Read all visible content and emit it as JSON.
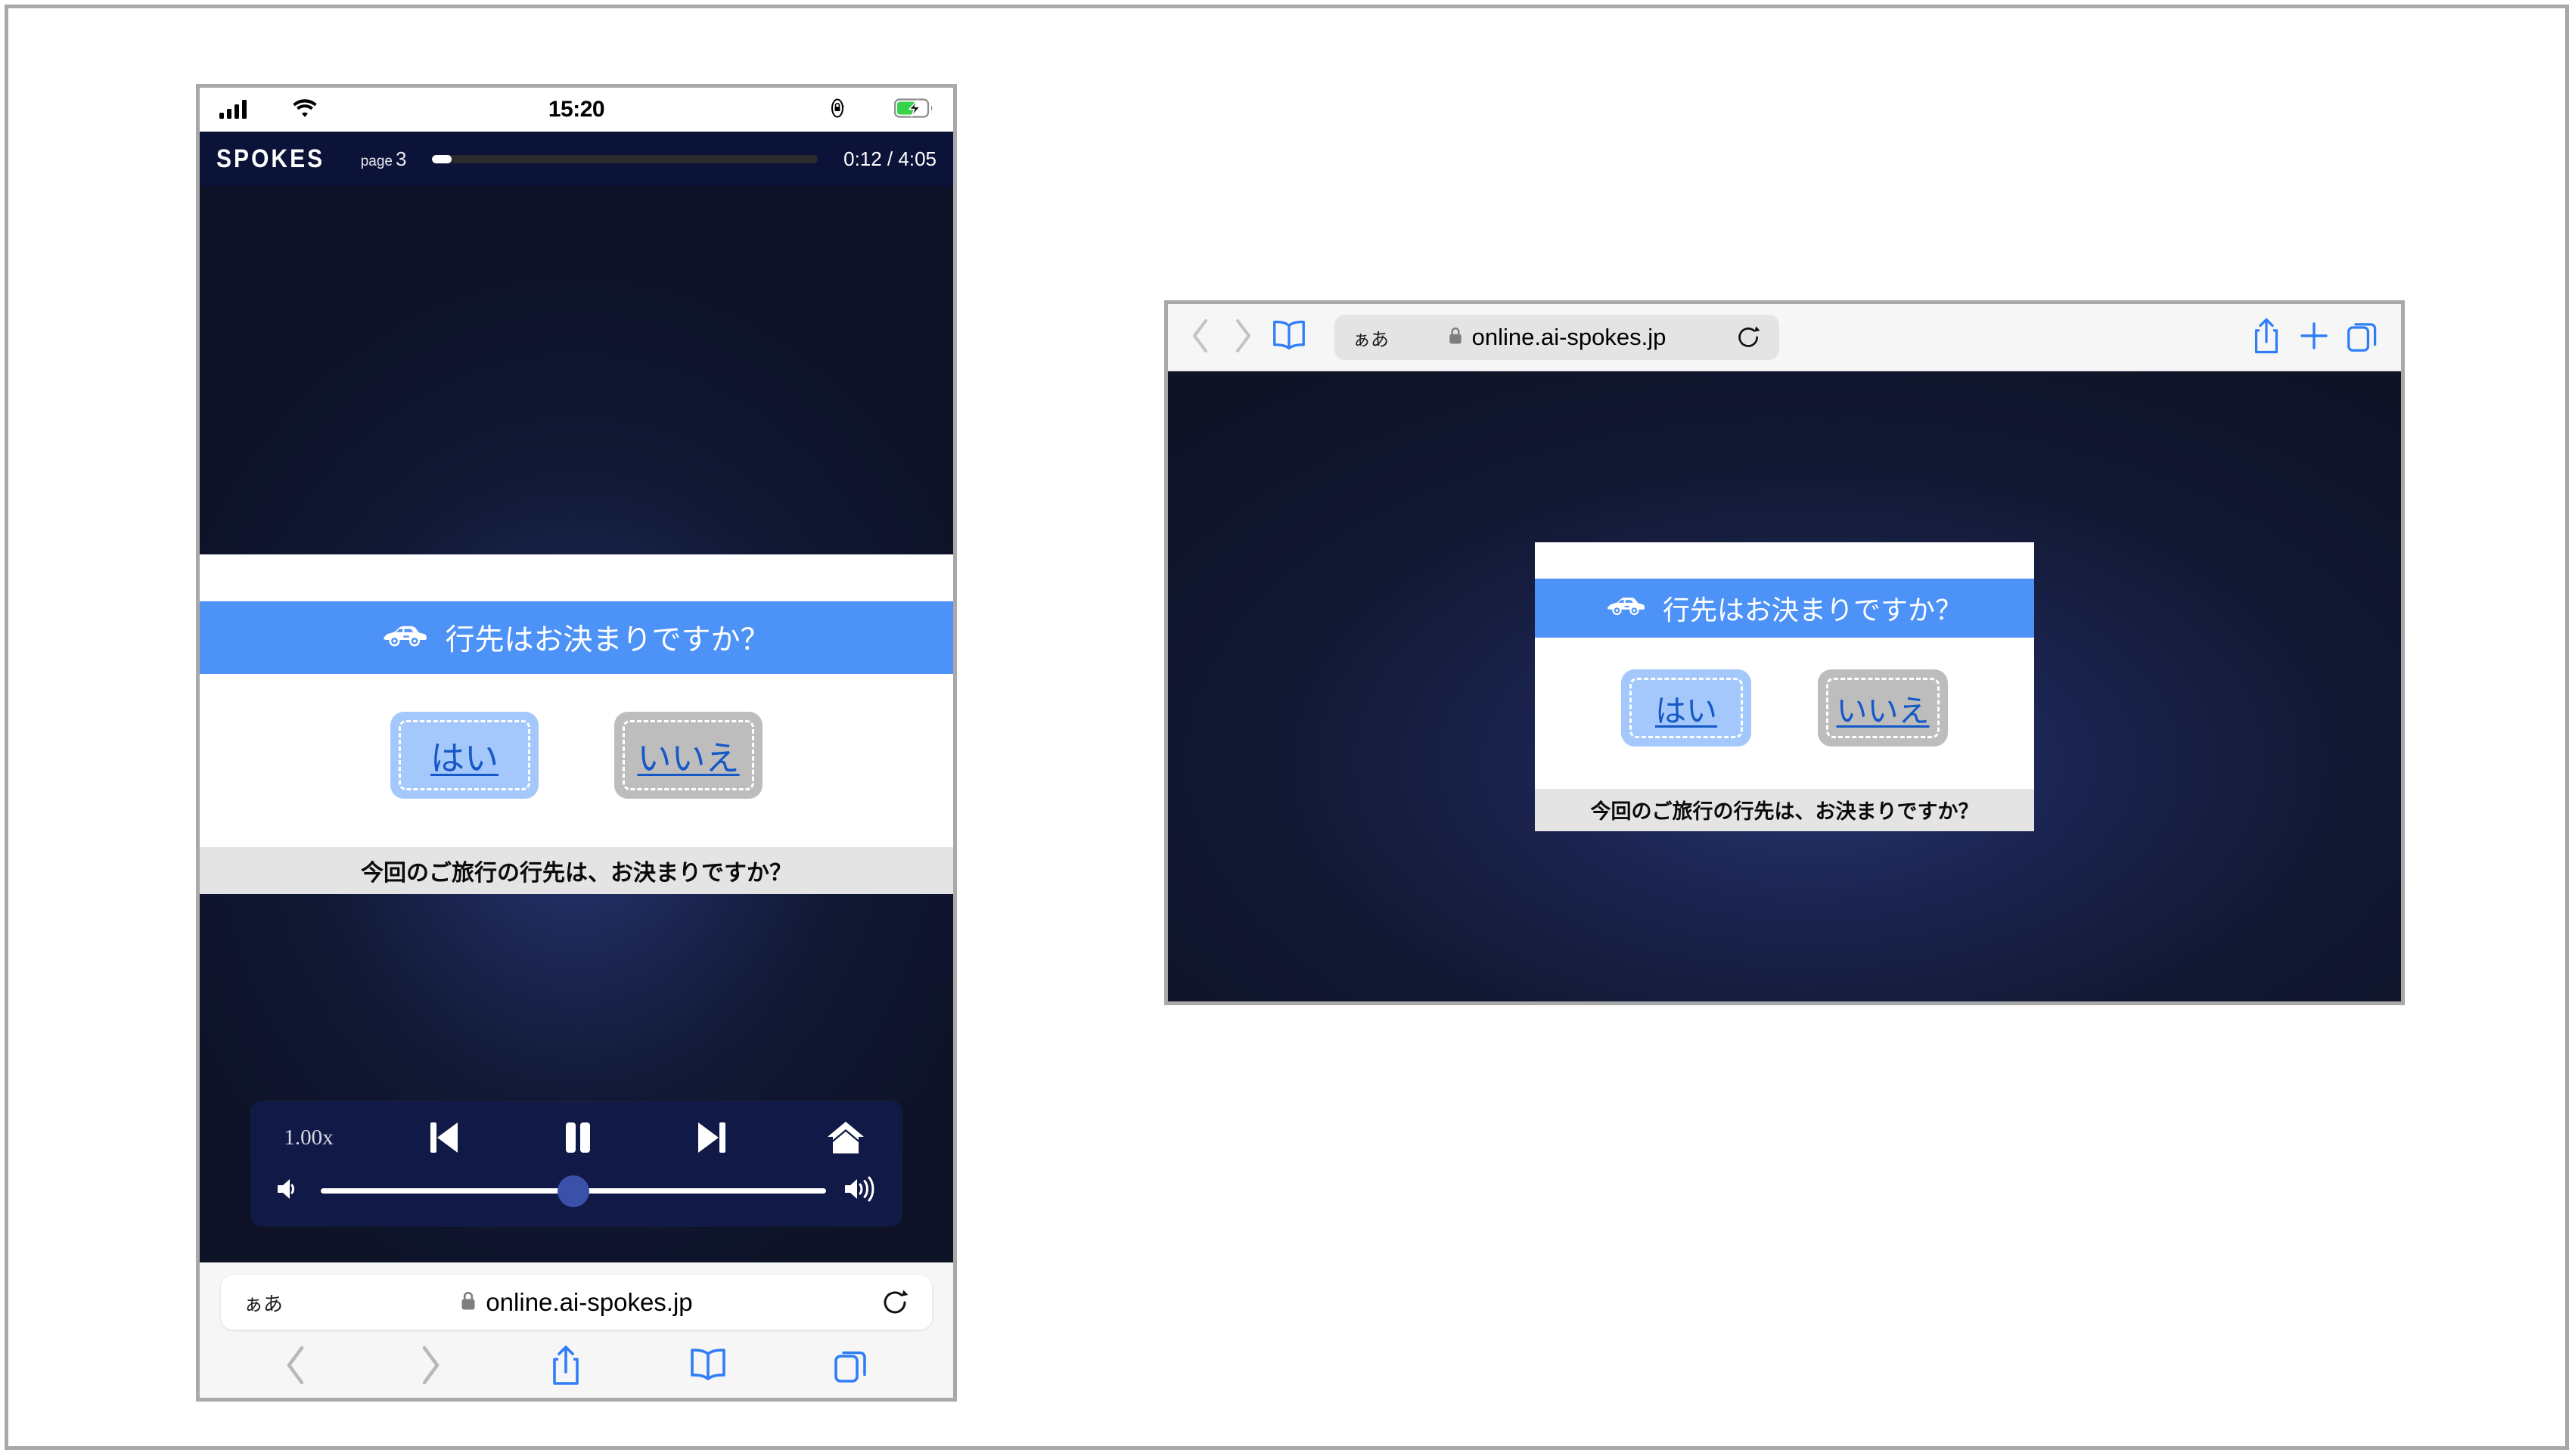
{
  "phone": {
    "status_bar": {
      "signal_icon": "cellular-signal-icon",
      "wifi_icon": "wifi-icon",
      "time": "15:20",
      "orientation_lock_icon": "rotation-lock-icon",
      "battery_icon": "battery-charging-icon"
    },
    "app_header": {
      "brand": "SPOKES",
      "page_word": "page",
      "page_number": "3",
      "progress_percent": 5,
      "time_elapsed": "0:12",
      "time_separator": "/",
      "time_total": "4:05",
      "time_display": "0:12 / 4:05"
    },
    "slide": {
      "question_icon": "car-icon",
      "question_text": "行先はお決まりですか？",
      "answers": [
        {
          "label": "はい",
          "variant": "primary"
        },
        {
          "label": "いいえ",
          "variant": "secondary"
        }
      ],
      "caption": "今回のご旅行の行先は、お決まりですか？"
    },
    "player": {
      "speed_label": "1.00x",
      "prev_icon": "skip-previous-icon",
      "pause_icon": "pause-icon",
      "next_icon": "skip-next-icon",
      "home_icon": "home-icon",
      "volume_low_icon": "volume-low-icon",
      "volume_high_icon": "volume-high-icon",
      "volume_percent": 50
    },
    "safari": {
      "text_size_label": "ぁあ",
      "lock_icon": "lock-icon",
      "url": "online.ai-spokes.jp",
      "reload_icon": "reload-icon",
      "back_icon": "chevron-left-icon",
      "forward_icon": "chevron-right-icon",
      "share_icon": "share-icon",
      "bookmarks_icon": "book-icon",
      "tabs_icon": "tabs-icon"
    }
  },
  "tablet": {
    "toolbar": {
      "back_icon": "chevron-left-icon",
      "forward_icon": "chevron-right-icon",
      "bookmarks_icon": "book-icon",
      "text_size_label": "ぁあ",
      "lock_icon": "lock-icon",
      "url": "online.ai-spokes.jp",
      "reload_icon": "reload-icon",
      "share_icon": "share-icon",
      "new_tab_icon": "plus-icon",
      "tabs_icon": "tabs-icon"
    },
    "slide": {
      "question_icon": "car-icon",
      "question_text": "行先はお決まりですか？",
      "answers": [
        {
          "label": "はい",
          "variant": "primary"
        },
        {
          "label": "いいえ",
          "variant": "secondary"
        }
      ],
      "caption": "今回のご旅行の行先は、お決まりですか？"
    }
  },
  "colors": {
    "brand_navy": "#0c1338",
    "accent_blue": "#4d92f7",
    "answer_yes_bg": "#a4c8fb",
    "answer_no_bg": "#bdbdbd",
    "answer_text": "#1558c6",
    "caption_bg": "#e4e4e4",
    "player_bg": "#111a47",
    "volume_knob": "#3b50a8",
    "safari_chrome": "#f6f6f6",
    "safari_tint": "#007aff"
  }
}
